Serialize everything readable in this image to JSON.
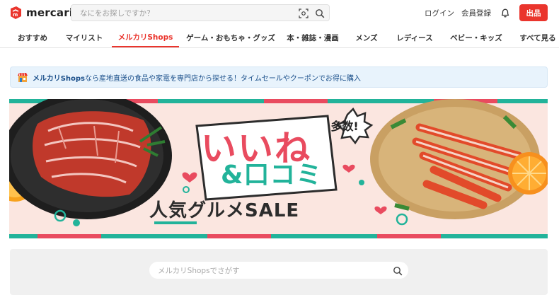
{
  "header": {
    "logo_text": "mercari",
    "search_placeholder": "なにをお探しですか？",
    "login_label": "ログイン",
    "signup_label": "会員登録",
    "sell_label": "出品"
  },
  "nav": {
    "items": [
      {
        "label": "おすすめ"
      },
      {
        "label": "マイリスト"
      },
      {
        "label": "メルカリShops"
      },
      {
        "label": "ゲーム・おもちゃ・グッズ"
      },
      {
        "label": "本・雑誌・漫画"
      },
      {
        "label": "メンズ"
      },
      {
        "label": "レディース"
      },
      {
        "label": "ベビー・キッズ"
      },
      {
        "label": "すべて見る"
      }
    ],
    "active_index": 2
  },
  "info_banner": {
    "brand": "メルカリShops",
    "text": "なら産地直送の食品や家電を専門店から探せる！タイムセールやクーポンでお得に購入"
  },
  "hero": {
    "line1": "いいね",
    "badge": "多数!",
    "line2": "&口コミ",
    "line3": "人気グルメSALE"
  },
  "shops_search": {
    "placeholder": "メルカリShopsでさがす"
  },
  "colors": {
    "brand_red": "#ea352d",
    "teal": "#22b39a",
    "pink": "#e94b5f",
    "info_bg": "#e8f3fc"
  }
}
